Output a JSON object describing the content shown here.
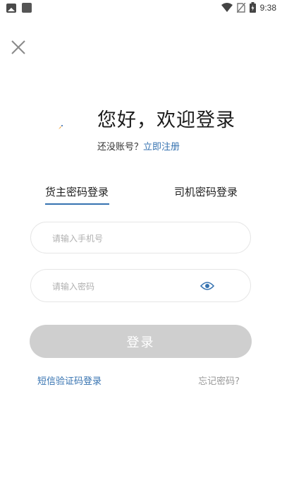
{
  "status_bar": {
    "time": "9:38",
    "icons": [
      "gallery-icon",
      "notification-square-icon",
      "wifi-icon",
      "no-sim-icon",
      "battery-charging-icon"
    ]
  },
  "header": {
    "close_icon": "close-icon"
  },
  "welcome": {
    "title": "您好，欢迎登录",
    "no_account_text": "还没账号？",
    "register_link": "立即注册"
  },
  "tabs": [
    {
      "label": "货主密码登录",
      "active": true
    },
    {
      "label": "司机密码登录",
      "active": false
    }
  ],
  "form": {
    "phone_placeholder": "请输入手机号",
    "password_placeholder": "请输入密码",
    "login_label": "登录"
  },
  "links": {
    "sms_login": "短信验证码登录",
    "forgot_password": "忘记密码?"
  },
  "colors": {
    "accent": "#3572b0",
    "button_disabled": "#cfcfcf",
    "logo_orange": "#f29a1f"
  }
}
